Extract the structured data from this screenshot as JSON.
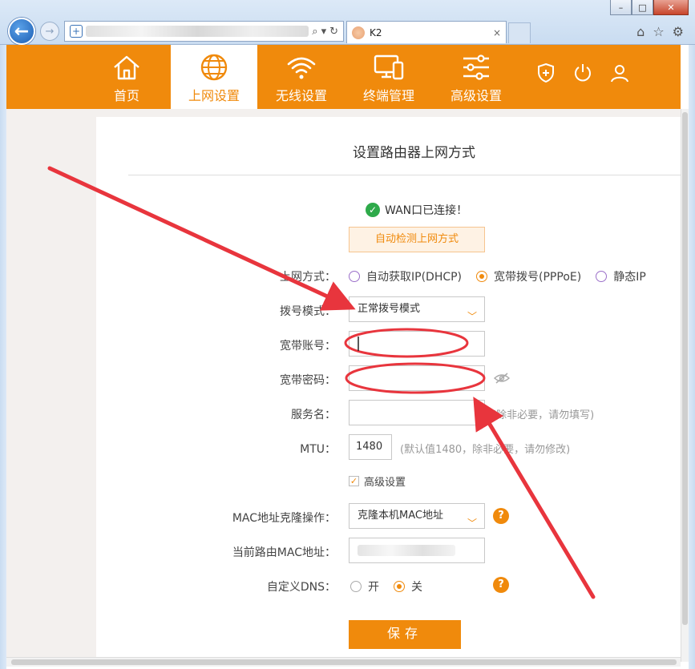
{
  "browser": {
    "tab_title": "K2",
    "tab_close": "×",
    "window_controls": [
      "–",
      "□",
      "✕"
    ]
  },
  "nav": {
    "items": [
      {
        "label": "首页",
        "icon": "home-icon"
      },
      {
        "label": "上网设置",
        "icon": "globe-icon"
      },
      {
        "label": "无线设置",
        "icon": "wifi-icon"
      },
      {
        "label": "终端管理",
        "icon": "devices-icon"
      },
      {
        "label": "高级设置",
        "icon": "sliders-icon"
      }
    ],
    "active_index": 1,
    "tools": [
      "shield-plus-icon",
      "power-icon",
      "user-icon"
    ]
  },
  "page": {
    "heading": "设置路由器上网方式",
    "status": "WAN口已连接！",
    "detect_button": "自动检测上网方式",
    "form": {
      "mode_label": "上网方式：",
      "mode_options": [
        "自动获取IP(DHCP)",
        "宽带拨号(PPPoE)",
        "静态IP"
      ],
      "mode_selected": 1,
      "dial_label": "拨号模式：",
      "dial_value": "正常拨号模式",
      "account_label": "宽带账号：",
      "account_value": "",
      "password_label": "宽带密码：",
      "password_value": "",
      "service_label": "服务名：",
      "service_value": "",
      "service_hint": "(除非必要，请勿填写)",
      "mtu_label": "MTU：",
      "mtu_value": "1480",
      "mtu_hint": "(默认值1480，除非必要，请勿修改)",
      "advanced_label": "高级设置",
      "advanced_checked": true,
      "mac_clone_label": "MAC地址克隆操作：",
      "mac_clone_value": "克隆本机MAC地址",
      "current_mac_label": "当前路由MAC地址：",
      "dns_label": "自定义DNS：",
      "dns_options": [
        "开",
        "关"
      ],
      "dns_selected": 1,
      "help_glyph": "?"
    },
    "save_button": "保存"
  },
  "colors": {
    "brand_orange": "#f08a0c",
    "annotation_red": "#e8353d",
    "success_green": "#2eaa4a"
  }
}
